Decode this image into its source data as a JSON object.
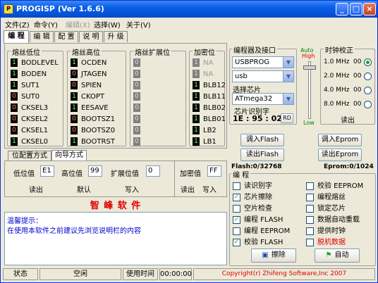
{
  "title": "PROGISP (Ver 1.6.6)",
  "menu": [
    "文件(Z)",
    "命令(Y)",
    "编辑(X)",
    "选择(W)",
    "关于(V)"
  ],
  "tabs": [
    "编 程",
    "编 辑",
    "配 置",
    "说 明",
    "升 级"
  ],
  "fuse_low": {
    "title": "熔丝低位",
    "rows": [
      [
        "1",
        "BODLEVEL"
      ],
      [
        "1",
        "BODEN"
      ],
      [
        "1",
        "SUT1"
      ],
      [
        "0",
        "SUT0"
      ],
      [
        "0",
        "CKSEL3"
      ],
      [
        "0",
        "CKSEL2"
      ],
      [
        "0",
        "CKSEL1"
      ],
      [
        "1",
        "CKSEL0"
      ]
    ]
  },
  "fuse_high": {
    "title": "熔丝高位",
    "rows": [
      [
        "1",
        "OCDEN"
      ],
      [
        "0",
        "JTAGEN"
      ],
      [
        "0",
        "SPIEN"
      ],
      [
        "1",
        "CKOPT"
      ],
      [
        "1",
        "EESAVE"
      ],
      [
        "0",
        "BOOTSZ1"
      ],
      [
        "0",
        "BOOTSZ0"
      ],
      [
        "1",
        "BOOTRST"
      ]
    ]
  },
  "fuse_ext": {
    "title": "熔丝扩展位",
    "rows": [
      "0",
      "0",
      "0",
      "0",
      "0",
      "0",
      "0",
      "0"
    ]
  },
  "lock": {
    "title": "加密位",
    "rows": [
      [
        "1",
        "NA"
      ],
      [
        "1",
        "NA"
      ],
      [
        "1",
        "BLB12"
      ],
      [
        "1",
        "BLB11"
      ],
      [
        "1",
        "BLB02"
      ],
      [
        "1",
        "BLB01"
      ],
      [
        "1",
        "LB2"
      ],
      [
        "1",
        "LB1"
      ]
    ]
  },
  "subtabs": [
    "位配置方式",
    "向导方式"
  ],
  "fuse_vals": {
    "low_label": "低位值",
    "low": "E1",
    "high_label": "高位值",
    "high": "99",
    "ext_label": "扩展位值",
    "ext": "0",
    "lock_label": "加密值",
    "lock": "FF"
  },
  "fuse_btns": {
    "read": "读出",
    "default": "默认",
    "write": "写入",
    "lock_read": "读出",
    "lock_write": "写入"
  },
  "brand": "智 峰 软 件",
  "notice": {
    "title": "温馨提示：",
    "text": "在使用本软件之前建议先浏览说明栏的内容"
  },
  "programmer": {
    "title": "编程器及接口",
    "device": "USBPROG",
    "port": "usb",
    "chip_title": "选择芯片",
    "chip": "ATmega32",
    "sig_title": "芯片识别字",
    "sig": "1E : 95 : 02",
    "rd": "RD"
  },
  "level": {
    "auto": "Auto",
    "high": "High",
    "low": "Low"
  },
  "clock": {
    "title": "时钟校正",
    "options": [
      "1.0 MHz",
      "2.0 MHz",
      "4.0 MHz",
      "8.0 MHz"
    ],
    "values": [
      "00",
      "00",
      "00",
      "00"
    ],
    "read": "读出"
  },
  "flash": {
    "load": "调入Flash",
    "read": "读出Flash",
    "status": "Flash:0/32768"
  },
  "eprom": {
    "load": "调入Eprom",
    "read": "读出Eprom",
    "status": "Eprom:0/1024"
  },
  "program": {
    "title": "编 程",
    "left": [
      {
        "label": "读识别字",
        "checked": false
      },
      {
        "label": "芯片擦除",
        "checked": true
      },
      {
        "label": "空片检查",
        "checked": false
      },
      {
        "label": "编程 FLASH",
        "checked": true
      },
      {
        "label": "编程 EEPROM",
        "checked": false
      },
      {
        "label": "校验 FLASH",
        "checked": true
      }
    ],
    "right": [
      {
        "label": "校验 EEPROM",
        "checked": false
      },
      {
        "label": "编程熔丝",
        "checked": false
      },
      {
        "label": "锁定芯片",
        "checked": false
      },
      {
        "label": "数据自动重载",
        "checked": false
      },
      {
        "label": "提供时钟",
        "checked": false
      },
      {
        "label": "脱机数据",
        "checked": false,
        "red": true
      }
    ],
    "erase": "擦除",
    "auto": "自动"
  },
  "statusbar": {
    "state_label": "状态",
    "state": "空闲",
    "time_label": "使用时间",
    "time": "00:00:00",
    "copyright": "Copyright(r) Zhifeng Software,Inc 2007"
  }
}
